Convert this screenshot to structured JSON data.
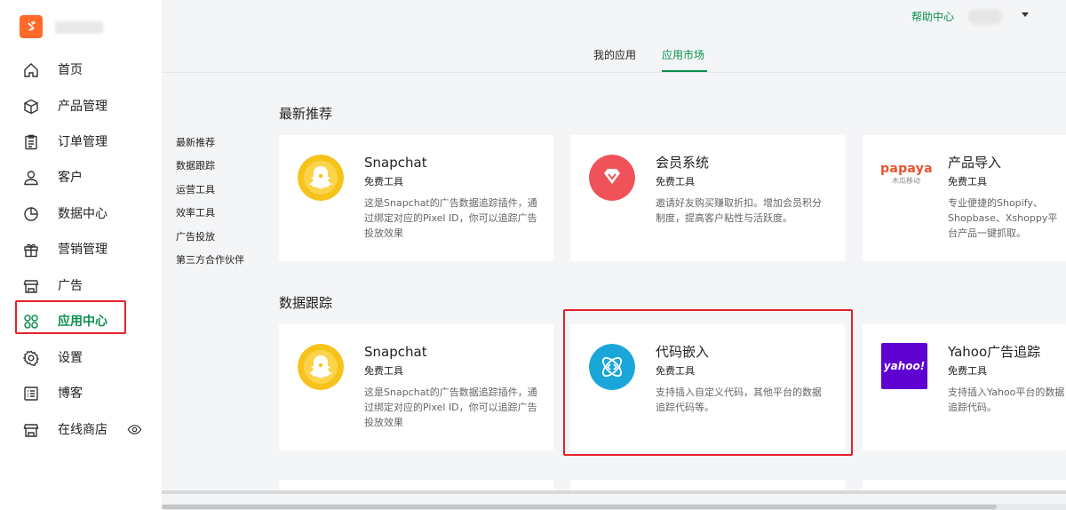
{
  "sidebar": {
    "logo_glyph": "ゞ",
    "items": [
      {
        "label": "首页",
        "icon": "home-icon"
      },
      {
        "label": "产品管理",
        "icon": "package-icon"
      },
      {
        "label": "订单管理",
        "icon": "clipboard-icon"
      },
      {
        "label": "客户",
        "icon": "user-icon"
      },
      {
        "label": "数据中心",
        "icon": "pie-chart-icon"
      },
      {
        "label": "营销管理",
        "icon": "gift-icon"
      },
      {
        "label": "广告",
        "icon": "store-icon"
      },
      {
        "label": "应用中心",
        "icon": "apps-icon",
        "active": true
      },
      {
        "label": "设置",
        "icon": "gear-icon"
      },
      {
        "label": "博客",
        "icon": "list-icon"
      },
      {
        "label": "在线商店",
        "icon": "store-icon"
      }
    ]
  },
  "header": {
    "help": "帮助中心"
  },
  "tabs": [
    {
      "label": "我的应用"
    },
    {
      "label": "应用市场",
      "active": true
    }
  ],
  "categories": [
    "最新推荐",
    "数据跟踪",
    "运营工具",
    "效率工具",
    "广告投放",
    "第三方合作伙伴"
  ],
  "sections": [
    {
      "title": "最新推荐",
      "cards": [
        {
          "title": "Snapchat",
          "tag": "免费工具",
          "desc": "这是Snapchat的广告数据追踪插件，通过绑定对应的Pixel ID，你可以追踪广告投放效果",
          "icon": "snapchat-icon"
        },
        {
          "title": "会员系统",
          "tag": "免费工具",
          "desc": "邀请好友购买赚取折扣。增加会员积分制度，提高客户粘性与活跃度。",
          "icon": "diamond-icon"
        },
        {
          "title": "产品导入",
          "tag": "免费工具",
          "desc": "专业便捷的Shopify、Shopbase、Xshoppy平台产品一键抓取。",
          "icon": "papaya-logo",
          "logo_text": "papaya",
          "logo_sub": "木瓜移动"
        }
      ]
    },
    {
      "title": "数据跟踪",
      "cards": [
        {
          "title": "Snapchat",
          "tag": "免费工具",
          "desc": "这是Snapchat的广告数据追踪插件，通过绑定对应的Pixel ID，你可以追踪广告投放效果",
          "icon": "snapchat-icon"
        },
        {
          "title": "代码嵌入",
          "tag": "免费工具",
          "desc": "支持插入自定义代码，其他平台的数据追踪代码等。",
          "icon": "code-icon"
        },
        {
          "title": "Yahoo广告追踪",
          "tag": "免费工具",
          "desc": "支持插入Yahoo平台的数据追踪代码。",
          "icon": "yahoo-logo",
          "logo_text": "yahoo!"
        }
      ]
    }
  ],
  "colors": {
    "accent": "#0a8f4f",
    "highlight": "#e6202a",
    "snap": "#f7c21a",
    "vip": "#f0525a",
    "code": "#1aa6d9",
    "yahoo": "#5f01d1"
  }
}
